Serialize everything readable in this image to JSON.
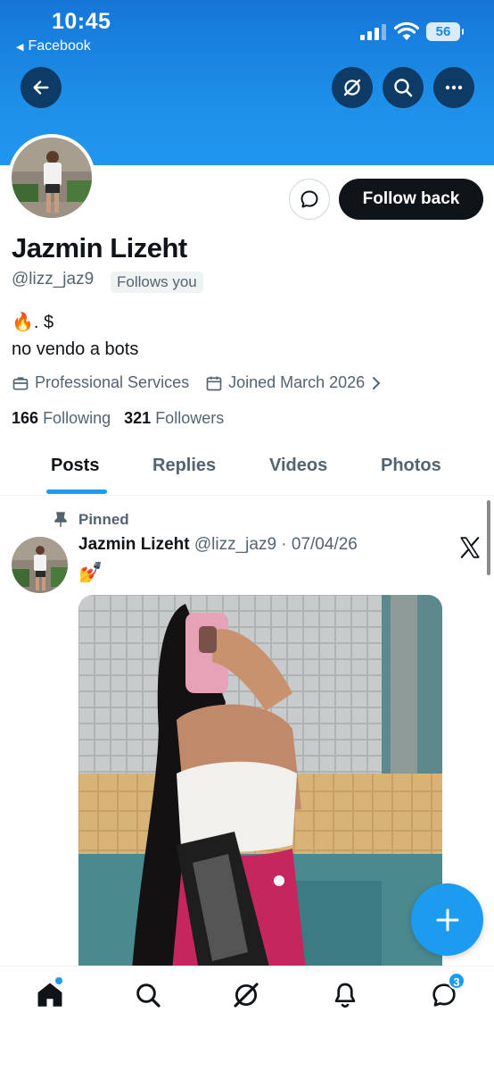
{
  "status": {
    "time": "10:45",
    "back_app": "Facebook",
    "battery": "56"
  },
  "profile": {
    "name": "Jazmin Lizeht",
    "handle": "@lizz_jaz9",
    "follows_you": "Follows you",
    "follow_back": "Follow back",
    "bio_line1": "🔥. $",
    "bio_line2": "no vendo a bots",
    "category": "Professional Services",
    "joined": "Joined March 2026",
    "following_count": "166",
    "following_label": "Following",
    "followers_count": "321",
    "followers_label": "Followers"
  },
  "tabs": [
    "Posts",
    "Replies",
    "Videos",
    "Photos"
  ],
  "active_tab": "Posts",
  "post": {
    "pinned_label": "Pinned",
    "author": "Jazmin Lizeht",
    "meta": "@lizz_jaz9 · 07/04/26",
    "text": "💅"
  },
  "bottom_nav": {
    "items": [
      "home-icon",
      "search-icon",
      "grok-icon",
      "notifications-icon",
      "messages-icon"
    ],
    "messages_badge": "3"
  },
  "colors": {
    "accent": "#1d9bf0",
    "dark": "#0f1419",
    "muted": "#536471",
    "banner": "#1d8fe8"
  }
}
